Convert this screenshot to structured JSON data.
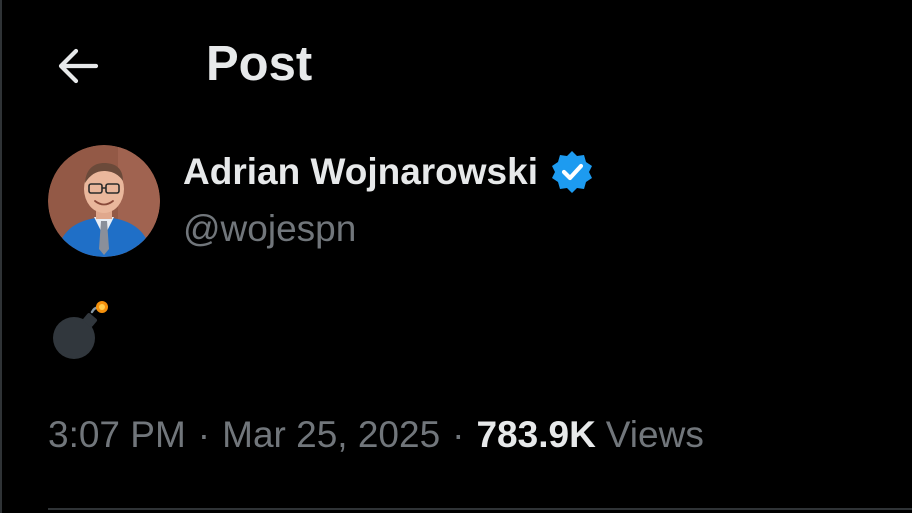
{
  "header": {
    "title": "Post",
    "back_icon": "arrow-left-icon"
  },
  "author": {
    "display_name": "Adrian Wojnarowski",
    "handle": "@wojespn",
    "verified": true,
    "verified_icon": "verified-badge-icon",
    "verified_color": "#1d9bf0"
  },
  "post": {
    "content_emoji": "bomb-emoji",
    "time": "3:07 PM",
    "separator": "·",
    "date": "Mar 25, 2025",
    "views_count": "783.9K",
    "views_label": "Views"
  },
  "colors": {
    "background": "#000000",
    "primary_text": "#e7e9ea",
    "secondary_text": "#71767b",
    "divider": "#2f3336"
  }
}
